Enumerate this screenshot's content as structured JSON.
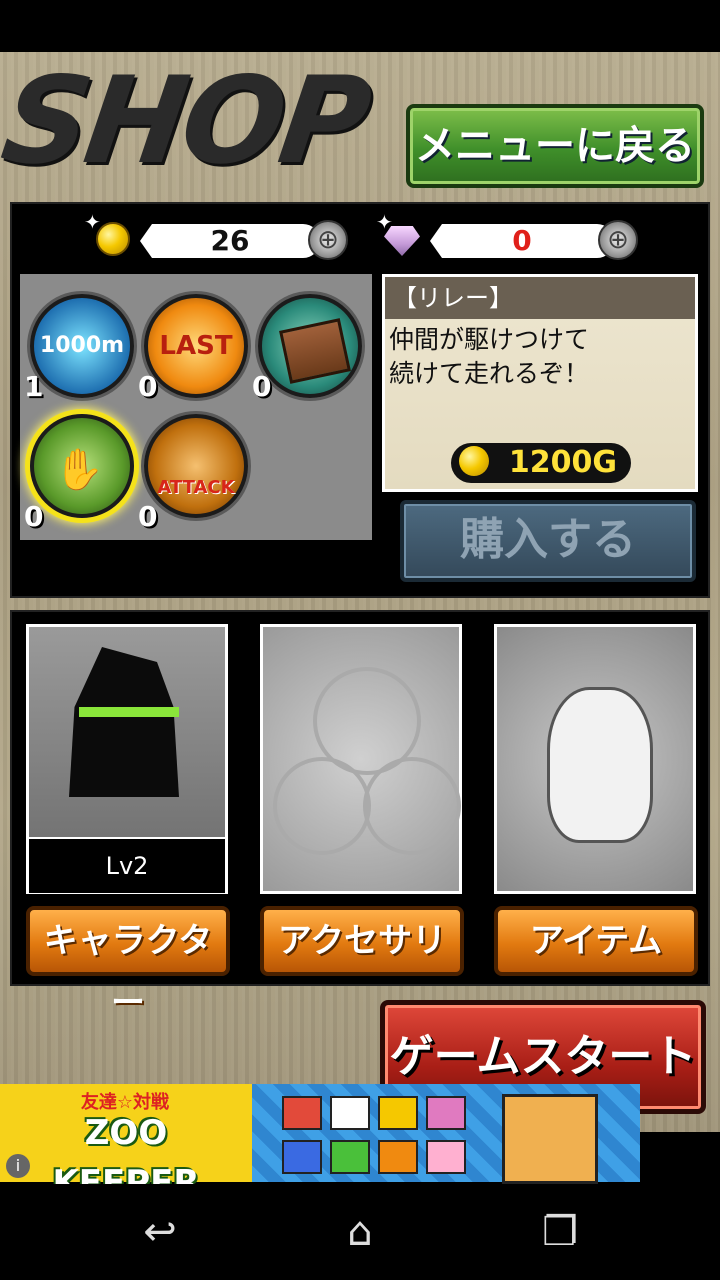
{
  "header": {
    "title": "SHOP",
    "back_label": "メニューに戻る"
  },
  "currency": {
    "gold": "26",
    "gems": "0",
    "plus_symbol": "⊕"
  },
  "items": [
    {
      "label": "1000m",
      "count": "1"
    },
    {
      "label": "LAST",
      "count": "0"
    },
    {
      "label": "BOARD",
      "count": "0"
    },
    {
      "label": "RELAY",
      "count": "0"
    },
    {
      "label": "ATTACK",
      "count": "0"
    }
  ],
  "description": {
    "title": "【リレー】",
    "body": "仲間が駆けつけて\n続けて走れるぞ！",
    "price": "1200G"
  },
  "buy_label": "購入する",
  "character": {
    "level": "Lv2"
  },
  "tabs": {
    "character": "キャラクター",
    "accessory": "アクセサリ",
    "item": "アイテム"
  },
  "start_label": "ゲームスタート",
  "ad": {
    "title": "ZOO KEEPER",
    "subtitle": "友達☆対戦",
    "info": "i"
  },
  "colors": {
    "gem_count": "#e0201a",
    "gold": "#f5c800",
    "green_button": "#3f8f2a",
    "orange_button": "#e27a10",
    "start_button": "#a81e16"
  }
}
